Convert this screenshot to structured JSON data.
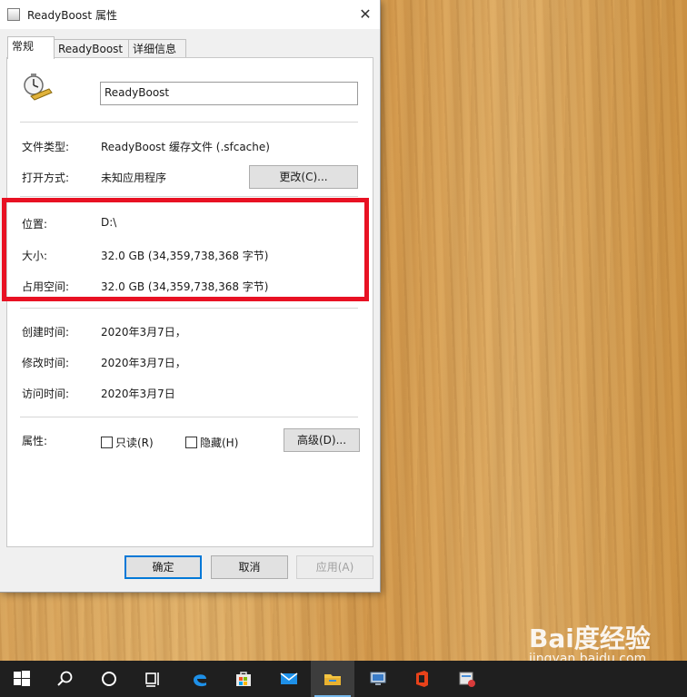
{
  "window": {
    "title": "ReadyBoost 属性",
    "close_glyph": "✕"
  },
  "tabs": [
    {
      "label": "常规",
      "active": true
    },
    {
      "label": "ReadyBoost",
      "active": false
    },
    {
      "label": "详细信息",
      "active": false
    }
  ],
  "general": {
    "file_name": "ReadyBoost",
    "file_type_label": "文件类型:",
    "file_type_value": "ReadyBoost 缓存文件 (.sfcache)",
    "open_with_label": "打开方式:",
    "open_with_value": "未知应用程序",
    "change_button": "更改(C)...",
    "location_label": "位置:",
    "location_value": "D:\\",
    "size_label": "大小:",
    "size_value": "32.0 GB (34,359,738,368 字节)",
    "size_on_disk_label": "占用空间:",
    "size_on_disk_value": "32.0 GB (34,359,738,368 字节)",
    "created_label": "创建时间:",
    "created_value": "2020年3月7日，",
    "modified_label": "修改时间:",
    "modified_value": "2020年3月7日，",
    "accessed_label": "访问时间:",
    "accessed_value": "2020年3月7日",
    "attributes_label": "属性:",
    "readonly_label": "只读(R)",
    "hidden_label": "隐藏(H)",
    "advanced_button": "高级(D)..."
  },
  "footer": {
    "ok_button": "确定",
    "cancel_button": "取消",
    "apply_button": "应用(A)"
  },
  "taskbar": {
    "items": [
      "start-icon",
      "search-icon",
      "cortana-icon",
      "task-view-icon",
      "edge-icon",
      "store-icon",
      "mail-icon",
      "file-explorer-icon",
      "computer-icon",
      "office-icon",
      "app-icon"
    ],
    "active_item": "file-explorer-icon"
  },
  "watermark": {
    "logo": "Bai度经验",
    "url": "jingyan.baidu.com"
  },
  "colors": {
    "highlight_border": "#e81123",
    "accent": "#0078d7",
    "taskbar": "#1f1f1f"
  }
}
